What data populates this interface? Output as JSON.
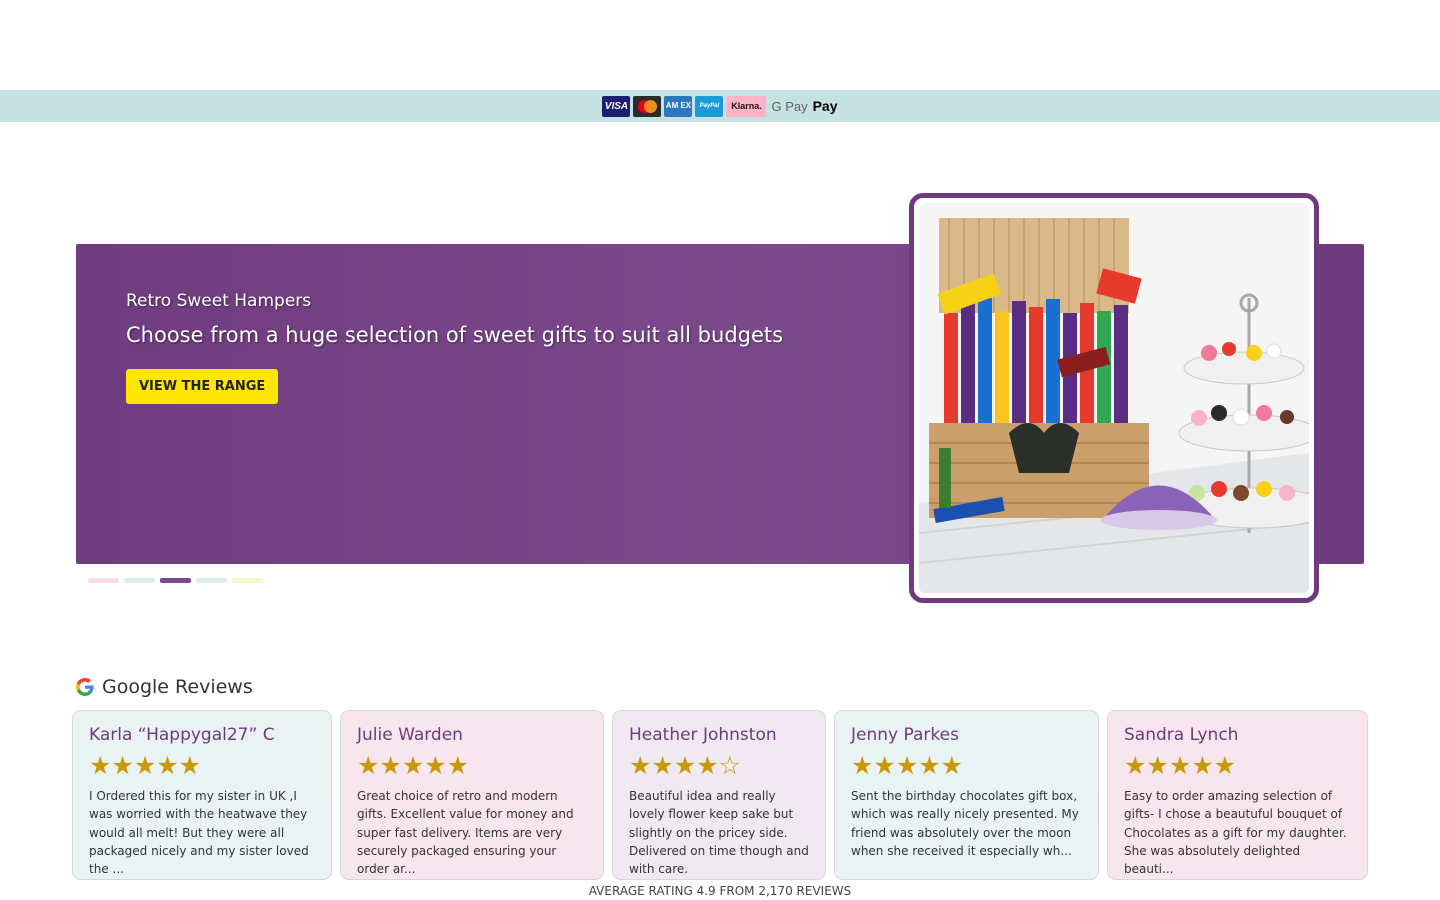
{
  "payment_methods": {
    "visa": "VISA",
    "amex": "AM EX",
    "paypal": "PayPal",
    "klarna": "Klarna.",
    "gpay": "G Pay",
    "applepay": " Pay"
  },
  "hero": {
    "kicker": "Retro Sweet Hampers",
    "title": "Choose from a huge selection of sweet gifts to suit all budgets",
    "button_label": "VIEW THE RANGE",
    "background_color": "#703b7f",
    "button_color": "#ffe600"
  },
  "slider": {
    "active_index": 2,
    "dot_colors": [
      "#f9dde6",
      "#dcedec",
      "#7c4a8c",
      "#dcedec",
      "#f5f7c9"
    ]
  },
  "reviews": {
    "title": "Google Reviews",
    "icon": "google-icon",
    "items": [
      {
        "name": "Karla “Happygal27” C",
        "rating": 5,
        "stars": "★★★★★",
        "text": "I Ordered this for my sister in UK ,I was worried with the heatwave they would all melt! But they were all packaged nicely and my sister loved the ...",
        "bg": "#e9f3f3"
      },
      {
        "name": "Julie Warden",
        "rating": 5,
        "stars": "★★★★★",
        "text": "Great choice of retro and modern gifts. Excellent value for money and super fast delivery. Items are very securely packaged ensuring your order ar...",
        "bg": "#f8e6ef"
      },
      {
        "name": "Heather Johnston",
        "rating": 4,
        "stars": "★★★★☆",
        "text": "Beautiful idea and really lovely flower keep sake but slightly on the pricey side. Delivered on time though and with care.",
        "bg": "#f1e9f2"
      },
      {
        "name": "Jenny Parkes",
        "rating": 5,
        "stars": "★★★★★",
        "text": "Sent the birthday chocolates gift box, which was really nicely presented. My friend was absolutely over the moon when she received it especially wh...",
        "bg": "#e9f3f3"
      },
      {
        "name": "Sandra Lynch",
        "rating": 5,
        "stars": "★★★★★",
        "text": "Easy to order amazing selection of gifts- I chose a beautuful bouquet of Chocolates as a gift for my daughter. She was absolutely delighted beauti...",
        "bg": "#f8e6ef"
      }
    ],
    "average_label": "AVERAGE RATING 4.9 FROM 2,170 REVIEWS"
  }
}
